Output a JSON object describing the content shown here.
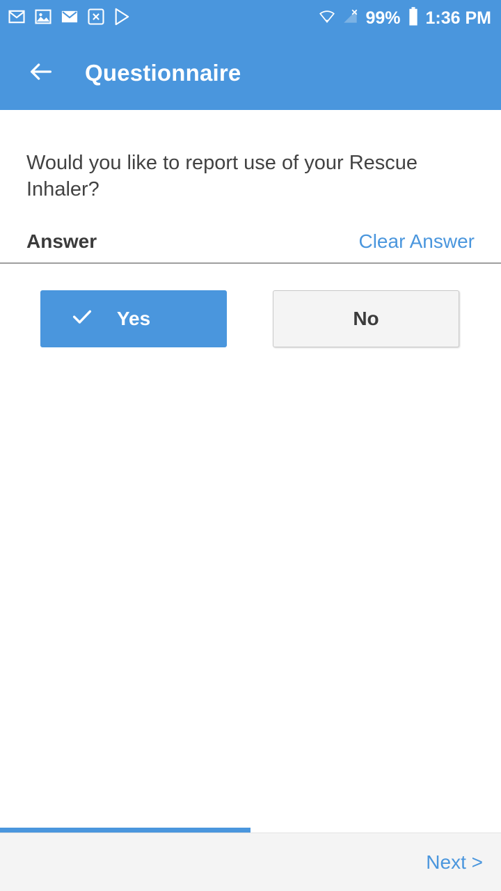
{
  "status_bar": {
    "background": "#4a96dd",
    "icons": [
      "gmail-icon",
      "photos-icon",
      "email-icon",
      "x-app-icon",
      "play-store-icon"
    ],
    "right_icons": [
      "wifi-icon",
      "cellular-signal-off-icon",
      "battery-icon"
    ],
    "battery_percent": "99%",
    "time": "1:36 PM"
  },
  "app_bar": {
    "back_icon": "arrow-back-icon",
    "title": "Questionnaire"
  },
  "main": {
    "question": "Would you like to report use of your Rescue Inhaler?",
    "answer_label": "Answer",
    "clear_answer_label": "Clear Answer",
    "choices": [
      {
        "label": "Yes",
        "selected": true,
        "icon": "check-icon"
      },
      {
        "label": "No",
        "selected": false,
        "icon": ""
      }
    ]
  },
  "progress": {
    "percent": 50,
    "fill_color": "#4a96dd"
  },
  "bottom_bar": {
    "next_label": "Next >"
  }
}
